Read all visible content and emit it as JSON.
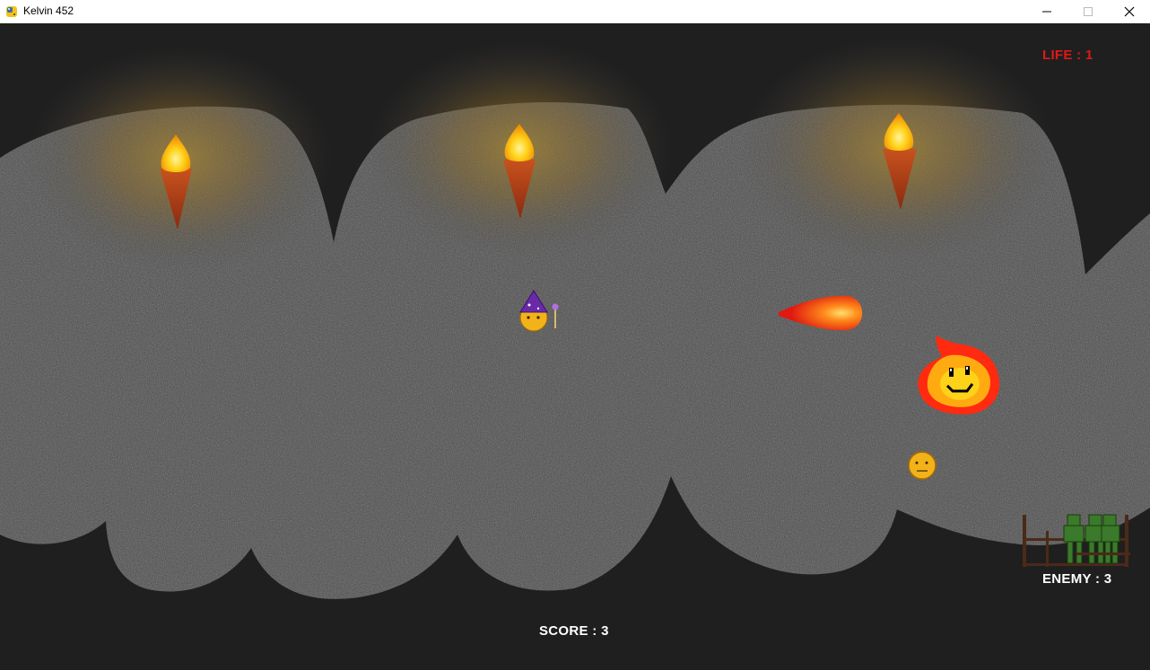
{
  "window": {
    "title": "Kelvin 452",
    "icon": "python-snake-icon",
    "controls": [
      "minimize-icon",
      "maximize-icon",
      "close-icon"
    ]
  },
  "hud": {
    "life_label": "LIFE : 1",
    "enemy_label": "ENEMY : 3",
    "score_label": "SCORE : 3"
  },
  "colors": {
    "background": "#1f1f1f",
    "cave_rock": "#4a4a4a",
    "life_text": "#e01818",
    "hud_text": "#ffffff",
    "torch_flame": "#ffcc00",
    "torch_handle": "#b0401a",
    "fire_enemy": "#ff3a10",
    "coin": "#f2b21a",
    "zombie": "#3a7a2a",
    "fence": "#4a2a18"
  },
  "sprites": {
    "torches": [
      "torch-icon",
      "torch-icon",
      "torch-icon"
    ],
    "player": "wizard-player-icon",
    "projectile": "fireball-icon",
    "enemy": "fire-blob-enemy-icon",
    "pickup": "coin-icon",
    "enemy_counter": "zombie-pen-icon"
  }
}
